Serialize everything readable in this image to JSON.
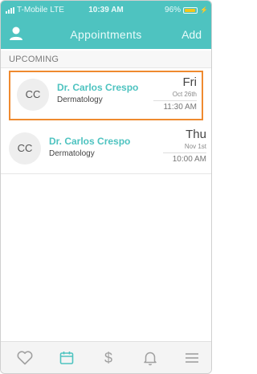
{
  "status_bar": {
    "carrier": "T-Mobile",
    "network": "LTE",
    "time": "10:39 AM",
    "battery": "96%",
    "battery_color": "#f5c518"
  },
  "nav": {
    "left_icon": "user-icon",
    "title": "Appointments",
    "add_label": "Add"
  },
  "section_header": "UPCOMING",
  "appointments": [
    {
      "initials": "CC",
      "doctor": "Dr. Carlos Crespo",
      "specialty": "Dermatology",
      "weekday": "Fri",
      "date": "Oct 26th",
      "time": "11:30 AM",
      "selected": true
    },
    {
      "initials": "CC",
      "doctor": "Dr. Carlos Crespo",
      "specialty": "Dermatology",
      "weekday": "Thu",
      "date": "Nov 1st",
      "time": "10:00 AM",
      "selected": false
    }
  ],
  "tab_bar": {
    "tabs": [
      "heart-icon",
      "calendar-icon",
      "dollar-icon",
      "bell-icon",
      "menu-icon"
    ],
    "active_tab": "calendar-icon"
  },
  "colors": {
    "brand": "#4ec3c0",
    "selection_outline": "#ef8a2f",
    "tab_icon": "#a0a0a0"
  }
}
